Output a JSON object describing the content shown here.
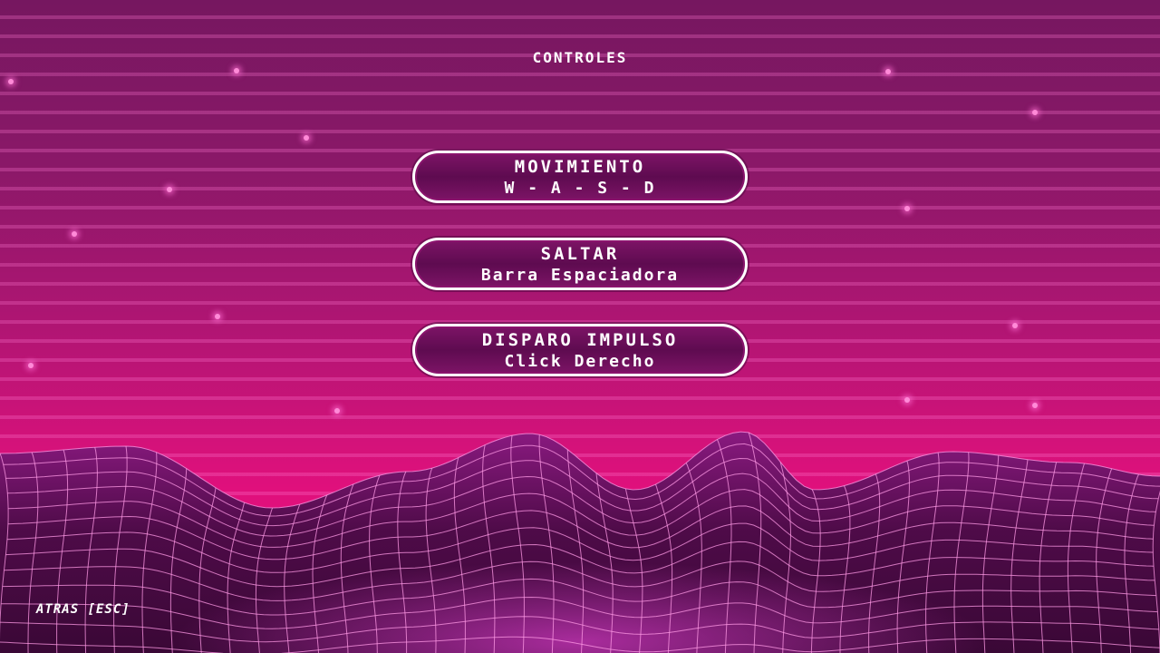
{
  "screen": {
    "title": "CONTROLES"
  },
  "controls": [
    {
      "action": "MOVIMIENTO",
      "key": "W - A - S - D"
    },
    {
      "action": "SALTAR",
      "key": "Barra Espaciadora"
    },
    {
      "action": "DISPARO IMPULSO",
      "key": "Click Derecho"
    }
  ],
  "back_button": {
    "label": "ATRAS [ESC]"
  },
  "colors": {
    "background_top": "#761760",
    "background_horizon": "#e0107c",
    "panel_fill": "#5e0b50",
    "panel_border": "#ffffff",
    "terrain_dark": "#3a0836",
    "grid_line": "#ff9ae6",
    "text": "#ffffff"
  }
}
